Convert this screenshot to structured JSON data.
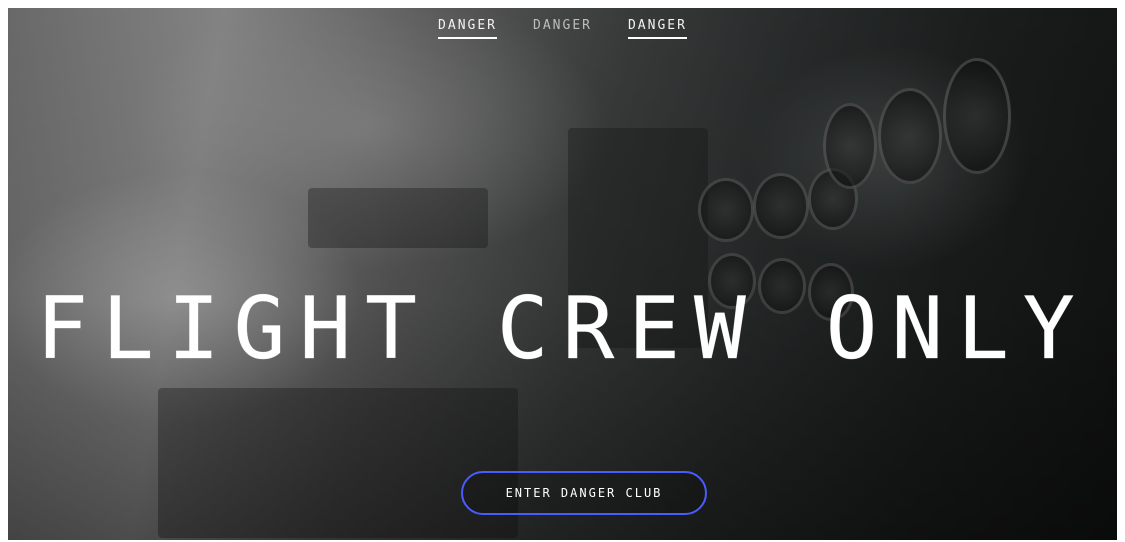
{
  "nav": {
    "items": [
      {
        "label": "DANGER",
        "active": true
      },
      {
        "label": "DANGER",
        "active": false
      },
      {
        "label": "DANGER",
        "active": true
      }
    ]
  },
  "hero": {
    "headline": "FLIGHT CREW ONLY",
    "cta_label": "ENTER DANGER CLUB"
  },
  "colors": {
    "cta_border": "#4a5cff",
    "text": "#ffffff"
  }
}
